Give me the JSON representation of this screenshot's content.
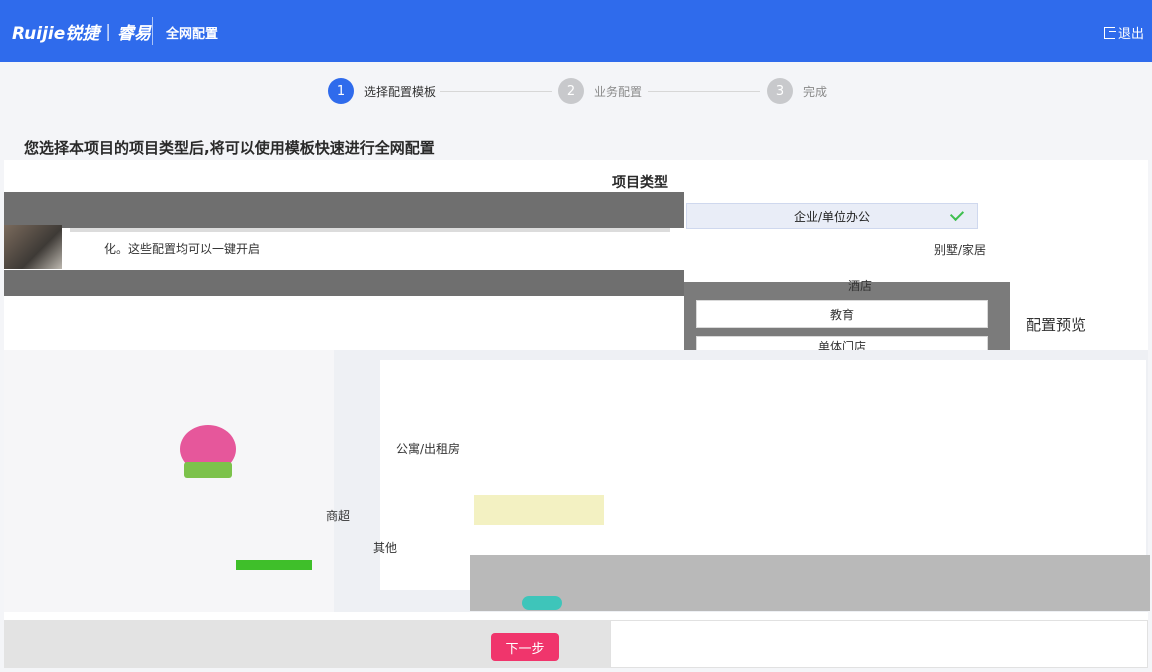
{
  "header": {
    "brand": "Ruijie锐捷",
    "brand_sub": "睿易",
    "nav_title": "全网配置",
    "logout_label": "退出"
  },
  "stepper": {
    "steps": [
      {
        "num": "1",
        "label": "选择配置模板",
        "state": "active"
      },
      {
        "num": "2",
        "label": "业务配置",
        "state": "todo"
      },
      {
        "num": "3",
        "label": "完成",
        "state": "todo"
      }
    ]
  },
  "page": {
    "heading": "您选择本项目的项目类型后,将可以使用模板快速进行全网配置",
    "hero_desc": "化。这些配置均可以一键开启",
    "preview_title": "配置预览"
  },
  "project_type": {
    "title": "项目类型",
    "options": [
      {
        "label": "企业/单位办公",
        "selected": true
      },
      {
        "label": "别墅/家居",
        "selected": false
      },
      {
        "label": "酒店",
        "selected": false
      },
      {
        "label": "教育",
        "selected": false
      },
      {
        "label": "单体门店",
        "selected": false
      },
      {
        "label": "公寓/出租房",
        "selected": false
      },
      {
        "label": "商超",
        "selected": false
      },
      {
        "label": "其他",
        "selected": false
      }
    ]
  },
  "footer": {
    "next_label": "下一步"
  },
  "colors": {
    "header_bg": "#2f6bec",
    "next_button_bg": "#f0356c",
    "check_color": "#3fbf4f"
  }
}
